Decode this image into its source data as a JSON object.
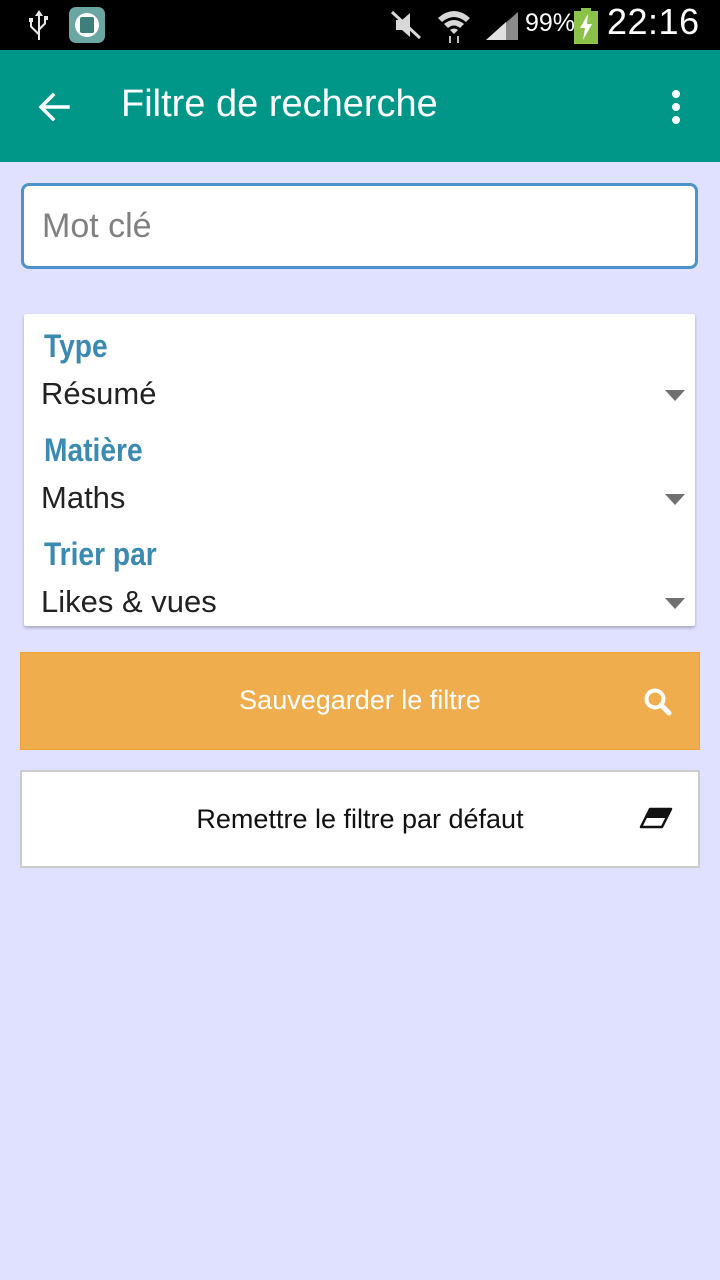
{
  "status_bar": {
    "battery_percent": "99%",
    "time": "22:16"
  },
  "app_bar": {
    "title": "Filtre de recherche"
  },
  "search": {
    "placeholder": "Mot clé",
    "value": ""
  },
  "filters": [
    {
      "label": "Type",
      "value": "Résumé"
    },
    {
      "label": "Matière",
      "value": "Maths"
    },
    {
      "label": "Trier par",
      "value": "Likes & vues"
    }
  ],
  "actions": {
    "save_label": "Sauvegarder le filtre",
    "reset_label": "Remettre le filtre par défaut"
  },
  "colors": {
    "app_bar": "#009688",
    "background": "#e0e1fe",
    "label": "#3a8ab2",
    "save_button": "#f0ad4e",
    "input_border": "#4d92ca"
  },
  "icons": {
    "back": "arrow-left-icon",
    "more": "more-vert-icon",
    "save": "search-icon",
    "reset": "eraser-icon"
  }
}
